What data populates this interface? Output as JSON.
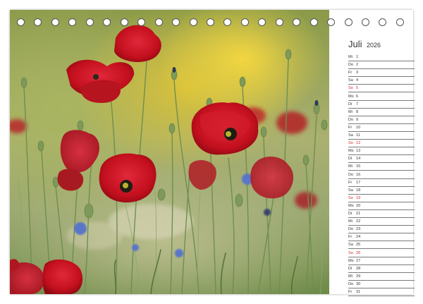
{
  "calendar": {
    "month": "Juli",
    "year": "2026",
    "accent_color": "#d0262b",
    "days": [
      {
        "wd": "Mi",
        "d": "1",
        "sunday": false
      },
      {
        "wd": "Do",
        "d": "2",
        "sunday": false
      },
      {
        "wd": "Fr",
        "d": "3",
        "sunday": false
      },
      {
        "wd": "Sa",
        "d": "4",
        "sunday": false
      },
      {
        "wd": "So",
        "d": "5",
        "sunday": true
      },
      {
        "wd": "Mo",
        "d": "6",
        "sunday": false
      },
      {
        "wd": "Di",
        "d": "7",
        "sunday": false
      },
      {
        "wd": "Mi",
        "d": "8",
        "sunday": false
      },
      {
        "wd": "Do",
        "d": "9",
        "sunday": false
      },
      {
        "wd": "Fr",
        "d": "10",
        "sunday": false
      },
      {
        "wd": "Sa",
        "d": "11",
        "sunday": false
      },
      {
        "wd": "So",
        "d": "12",
        "sunday": true
      },
      {
        "wd": "Mo",
        "d": "13",
        "sunday": false
      },
      {
        "wd": "Di",
        "d": "14",
        "sunday": false
      },
      {
        "wd": "Mi",
        "d": "15",
        "sunday": false
      },
      {
        "wd": "Do",
        "d": "16",
        "sunday": false
      },
      {
        "wd": "Fr",
        "d": "17",
        "sunday": false
      },
      {
        "wd": "Sa",
        "d": "18",
        "sunday": false
      },
      {
        "wd": "So",
        "d": "19",
        "sunday": true
      },
      {
        "wd": "Mo",
        "d": "20",
        "sunday": false
      },
      {
        "wd": "Di",
        "d": "21",
        "sunday": false
      },
      {
        "wd": "Mi",
        "d": "22",
        "sunday": false
      },
      {
        "wd": "Do",
        "d": "23",
        "sunday": false
      },
      {
        "wd": "Fr",
        "d": "24",
        "sunday": false
      },
      {
        "wd": "Sa",
        "d": "25",
        "sunday": false
      },
      {
        "wd": "So",
        "d": "26",
        "sunday": true
      },
      {
        "wd": "Mo",
        "d": "27",
        "sunday": false
      },
      {
        "wd": "Di",
        "d": "28",
        "sunday": false
      },
      {
        "wd": "Mi",
        "d": "29",
        "sunday": false
      },
      {
        "wd": "Do",
        "d": "30",
        "sunday": false
      },
      {
        "wd": "Fr",
        "d": "31",
        "sunday": false
      }
    ]
  },
  "binding": {
    "ring_count": 23
  }
}
